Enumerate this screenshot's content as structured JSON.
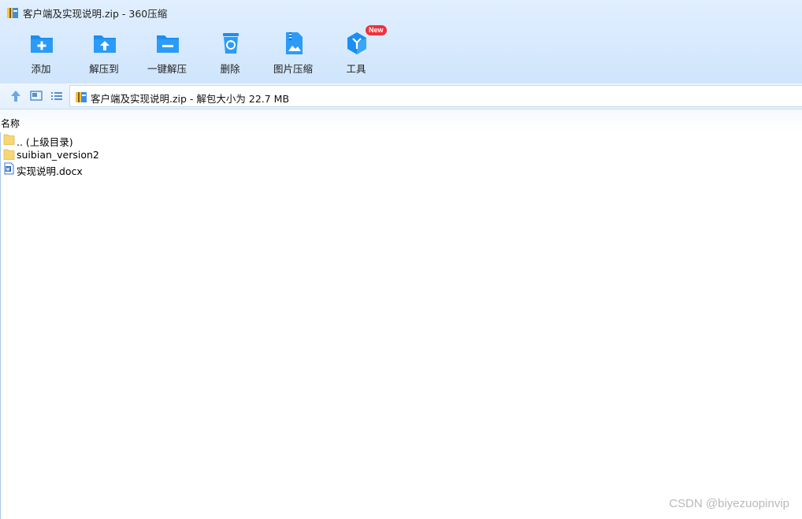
{
  "window": {
    "title": "客户端及实现说明.zip - 360压缩",
    "icon": "zip-archive-icon"
  },
  "toolbar": {
    "items": [
      {
        "label": "添加",
        "icon": "add-folder-icon"
      },
      {
        "label": "解压到",
        "icon": "extract-to-folder-icon"
      },
      {
        "label": "一键解压",
        "icon": "one-click-extract-icon"
      },
      {
        "label": "删除",
        "icon": "recycle-bin-icon"
      },
      {
        "label": "图片压缩",
        "icon": "image-compress-icon"
      },
      {
        "label": "工具",
        "icon": "tools-cube-icon",
        "badge": "New"
      }
    ]
  },
  "navbar": {
    "buttons": [
      "up-arrow-icon",
      "thumbnail-view-icon",
      "list-view-icon"
    ],
    "path": "客户端及实现说明.zip - 解包大小为 22.7 MB"
  },
  "columns": {
    "name": "名称"
  },
  "files": [
    {
      "name": ".. (上级目录)",
      "type": "parent-folder"
    },
    {
      "name": "suibian_version2",
      "type": "folder"
    },
    {
      "name": "实现说明.docx",
      "type": "word-document"
    }
  ],
  "watermark": "CSDN @biyezuopinvip",
  "colors": {
    "accent": "#1e90f5",
    "folder": "#f7d774",
    "badge": "#f0313c"
  }
}
